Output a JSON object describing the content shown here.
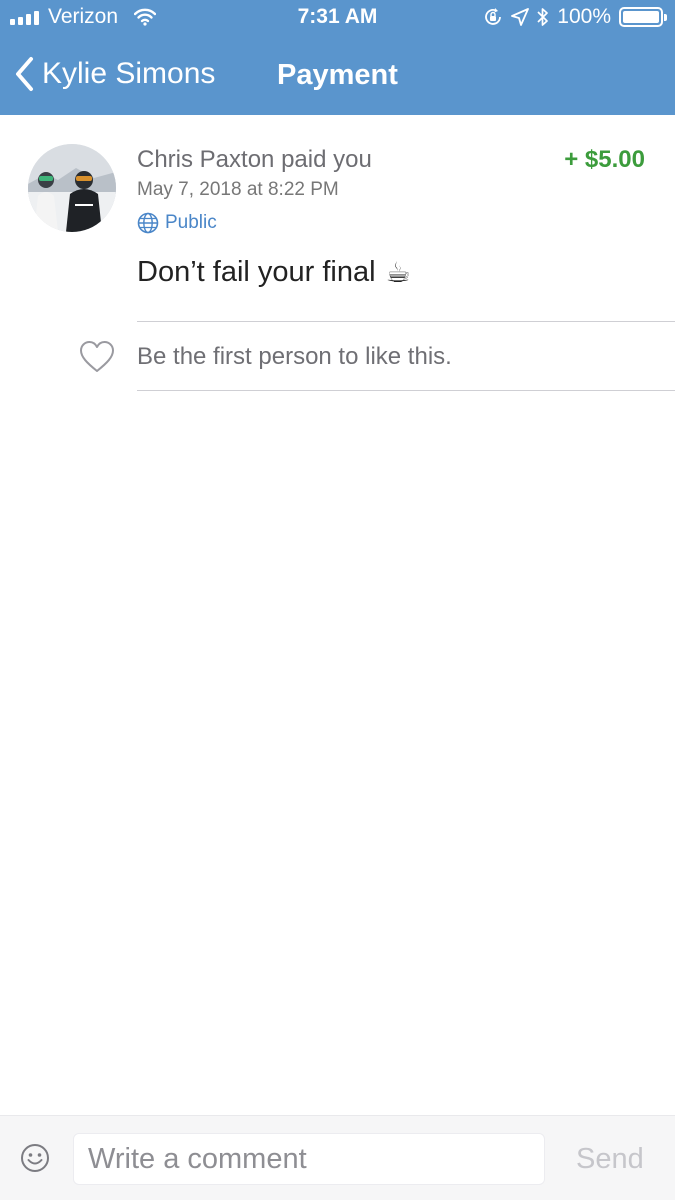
{
  "status_bar": {
    "carrier": "Verizon",
    "time": "7:31 AM",
    "battery_percent": "100%",
    "battery_level": 1.0,
    "icons": [
      "signal-icon",
      "wifi-icon",
      "orientation-lock-icon",
      "location-icon",
      "bluetooth-icon",
      "battery-icon"
    ]
  },
  "nav": {
    "back_label": "Kylie Simons",
    "title": "Payment"
  },
  "story": {
    "payer_name": "Chris Paxton",
    "action": "paid you",
    "amount": "+ $5.00",
    "timestamp": "May 7, 2018 at 8:22 PM",
    "privacy": "Public",
    "note": "Don’t fail your final",
    "note_emoji": "☕",
    "like_text": "Be the first person to like this."
  },
  "composer": {
    "placeholder": "Write a comment",
    "send_label": "Send"
  },
  "colors": {
    "header": "#5a95cd",
    "amount_positive": "#3c9c3c",
    "link_blue": "#4a86c8",
    "muted_text": "#6d6d72"
  }
}
